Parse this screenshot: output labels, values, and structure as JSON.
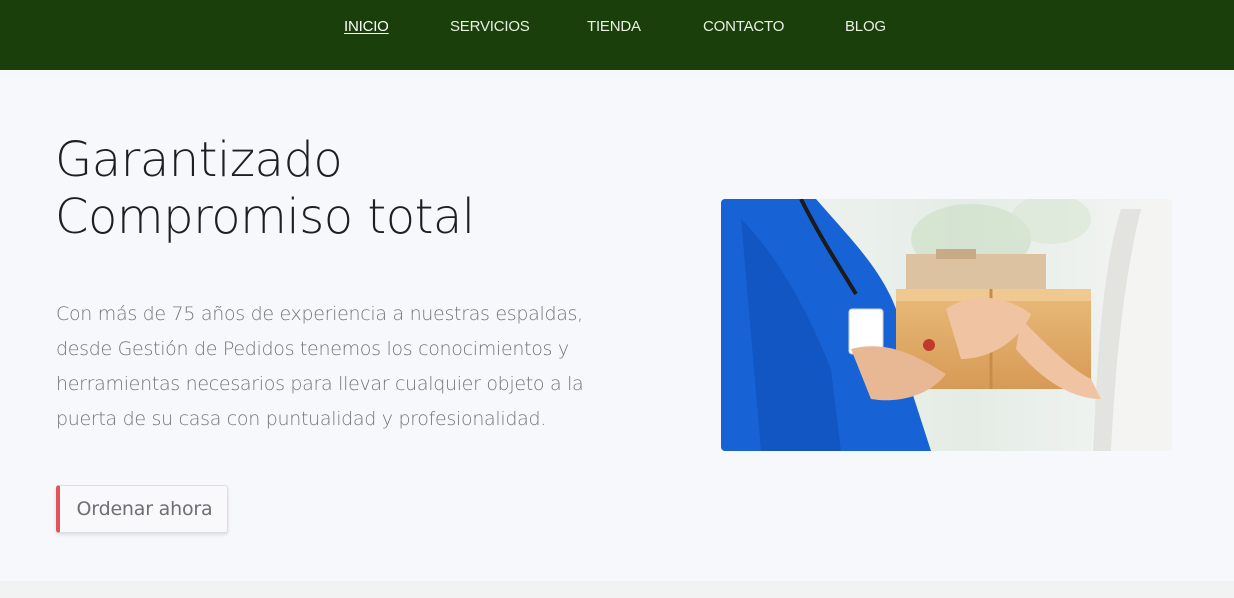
{
  "nav": {
    "items": [
      {
        "label": "INICIO",
        "active": true
      },
      {
        "label": "SERVICIOS",
        "active": false
      },
      {
        "label": "TIENDA",
        "active": false
      },
      {
        "label": "CONTACTO",
        "active": false
      },
      {
        "label": "BLOG",
        "active": false
      }
    ]
  },
  "hero": {
    "title_line1": "Garantizado",
    "title_line2": "Compromiso total",
    "description": "Con más de 75 años de experiencia a nuestras espaldas, desde Gestión de Pedidos tenemos los conocimientos y herramientas necesarios para llevar cualquier objeto a la puerta de su casa con puntualidad y profesionalidad.",
    "cta_label": "Ordenar ahora"
  },
  "colors": {
    "nav_background": "#1a3f0a",
    "page_background": "#f7f8fb",
    "button_accent": "#e2545a",
    "courier_shirt": "#1763d6"
  }
}
